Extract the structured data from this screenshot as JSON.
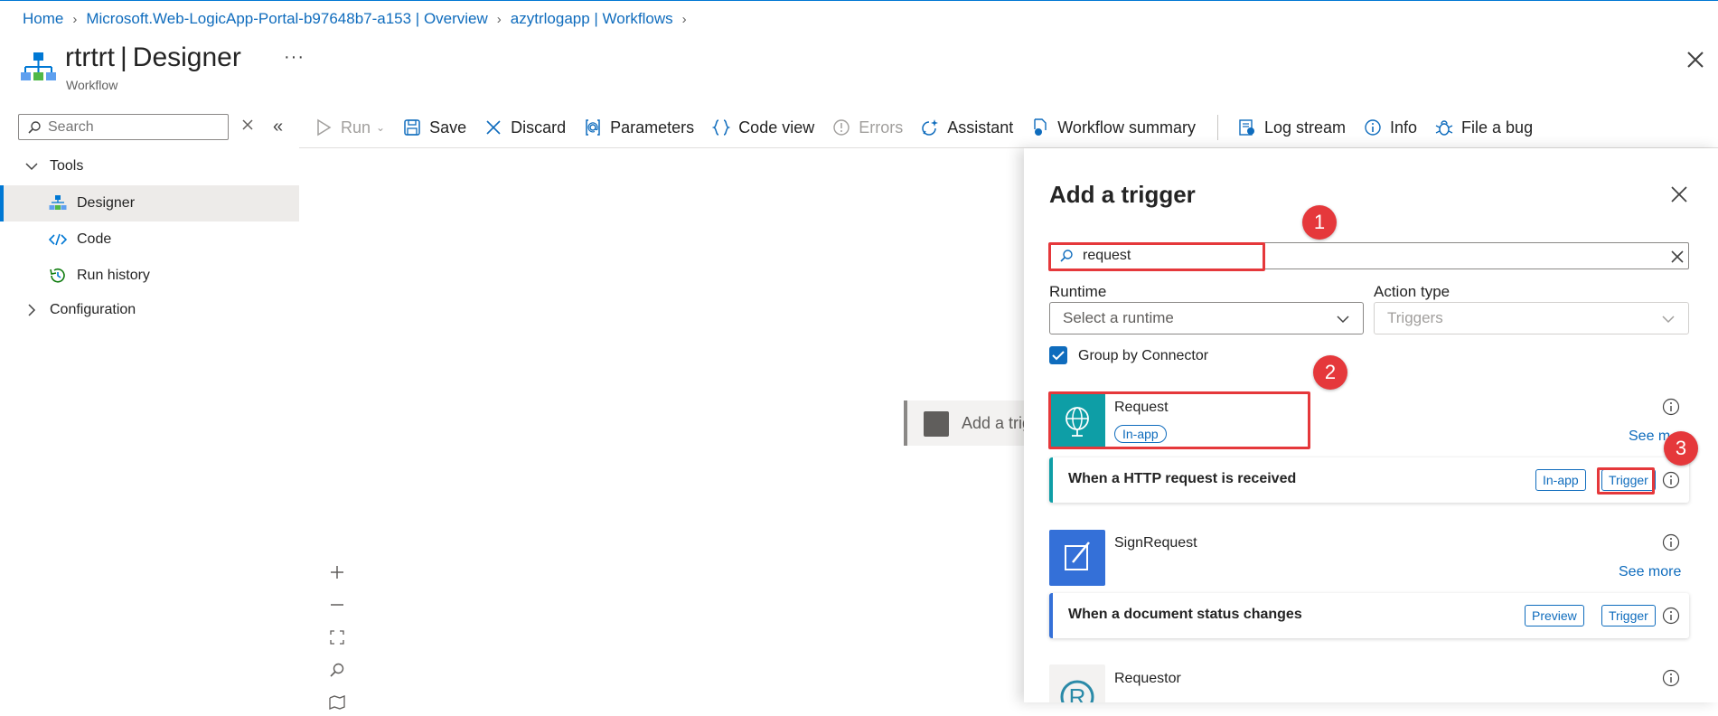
{
  "breadcrumb": {
    "items": [
      "Home",
      "Microsoft.Web-LogicApp-Portal-b97648b7-a153 | Overview",
      "azytrlogapp | Workflows"
    ]
  },
  "header": {
    "title_name": "rtrtrt",
    "title_page": "Designer",
    "separator": "|",
    "subtitle": "Workflow",
    "more_label": "···"
  },
  "sidebar": {
    "search_placeholder": "Search",
    "collapse_label": "«",
    "tools_label": "Tools",
    "items": [
      {
        "label": "Designer",
        "icon": "workflow-icon"
      },
      {
        "label": "Code",
        "icon": "code-icon"
      },
      {
        "label": "Run history",
        "icon": "history-icon"
      }
    ],
    "configuration_label": "Configuration"
  },
  "toolbar": {
    "run": "Run",
    "save": "Save",
    "discard": "Discard",
    "parameters": "Parameters",
    "code_view": "Code view",
    "errors": "Errors",
    "assistant": "Assistant",
    "workflow_summary": "Workflow summary",
    "log_stream": "Log stream",
    "info": "Info",
    "file_bug": "File a bug"
  },
  "canvas": {
    "add_trigger_node": "Add a trig"
  },
  "panel": {
    "title": "Add a trigger",
    "search_value": "request",
    "runtime_label": "Runtime",
    "runtime_placeholder": "Select a runtime",
    "action_type_label": "Action type",
    "action_type_value": "Triggers",
    "group_by_label": "Group by Connector",
    "group_by_checked": true,
    "connectors": [
      {
        "name": "Request",
        "badge": "In-app",
        "see_more": "See m",
        "color": "#0e9ea6",
        "trigger": {
          "name": "When a HTTP request is received",
          "tags": [
            "In-app",
            "Trigger"
          ]
        }
      },
      {
        "name": "SignRequest",
        "see_more": "See more",
        "color": "#3470d8",
        "trigger": {
          "name": "When a document status changes",
          "tags": [
            "Preview",
            "Trigger"
          ]
        }
      },
      {
        "name": "Requestor",
        "color": "#2a8aa8"
      }
    ],
    "callouts": [
      "1",
      "2",
      "3"
    ]
  },
  "colors": {
    "accent": "#0078d4",
    "link": "#0f6cbd",
    "highlight": "#e5383b"
  }
}
